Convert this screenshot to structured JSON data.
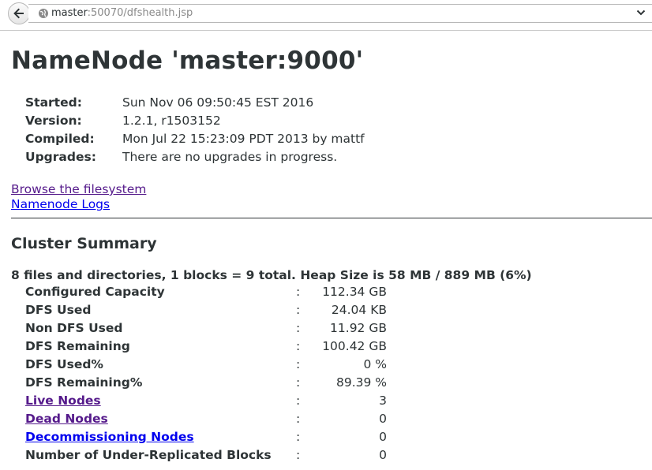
{
  "browser": {
    "url_host": "master",
    "url_rest": ":50070/dfshealth.jsp"
  },
  "page": {
    "title": "NameNode 'master:9000'",
    "info": [
      {
        "key": "Started:",
        "value": "Sun Nov 06 09:50:45 EST 2016"
      },
      {
        "key": "Version:",
        "value": "1.2.1, r1503152"
      },
      {
        "key": "Compiled:",
        "value": "Mon Jul 22 15:23:09 PDT 2013 by mattf"
      },
      {
        "key": "Upgrades:",
        "value": "There are no upgrades in progress."
      }
    ],
    "links": {
      "browse": "Browse the filesystem",
      "logs": "Namenode Logs"
    }
  },
  "cluster": {
    "title": "Cluster Summary",
    "summary": "8 files and directories, 1 blocks = 9 total. Heap Size is 58 MB / 889 MB (6%)",
    "separator": ":",
    "stats": [
      {
        "label": "Configured Capacity",
        "value": "112.34 GB"
      },
      {
        "label": "DFS Used",
        "value": "24.04 KB"
      },
      {
        "label": "Non DFS Used",
        "value": "11.92 GB"
      },
      {
        "label": "DFS Remaining",
        "value": "100.42 GB"
      },
      {
        "label": "DFS Used%",
        "value": "0 %"
      },
      {
        "label": "DFS Remaining%",
        "value": "89.39 %"
      },
      {
        "label": "Live Nodes",
        "value": "3"
      },
      {
        "label": "Dead Nodes",
        "value": "0"
      },
      {
        "label": "Decommissioning Nodes",
        "value": "0"
      },
      {
        "label": "Number of Under-Replicated Blocks",
        "value": "0"
      }
    ]
  },
  "colors": {
    "text": "#2e3436",
    "link_visited": "#551a8b",
    "link_unvisited": "#0000ee"
  }
}
